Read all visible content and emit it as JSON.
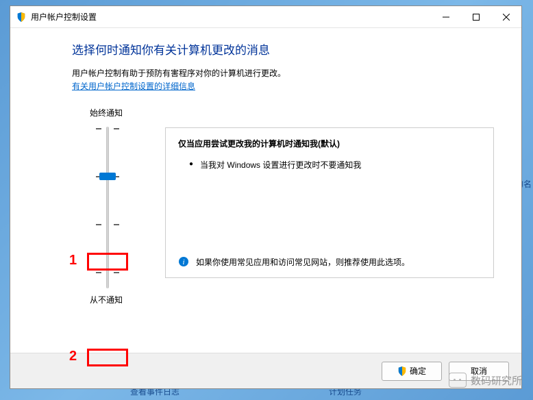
{
  "titlebar": {
    "title": "用户帐户控制设置"
  },
  "content": {
    "heading": "选择何时通知你有关计算机更改的消息",
    "description": "用户帐户控制有助于预防有害程序对你的计算机进行更改。",
    "link": "有关用户帐户控制设置的详细信息",
    "slider": {
      "top_label": "始终通知",
      "bottom_label": "从不通知"
    },
    "panel": {
      "title": "仅当应用尝试更改我的计算机时通知我(默认)",
      "bullet": "当我对 Windows 设置进行更改时不要通知我",
      "footer": "如果你使用常见应用和访问常见网站，则推荐使用此选项。"
    }
  },
  "buttons": {
    "ok": "确定",
    "cancel": "取消"
  },
  "annotations": {
    "one": "1",
    "two": "2"
  },
  "watermark": "数码研究所",
  "bg": {
    "right_text": "的名",
    "bottom_left": "查看事件日志",
    "bottom_right": "计划任务"
  }
}
